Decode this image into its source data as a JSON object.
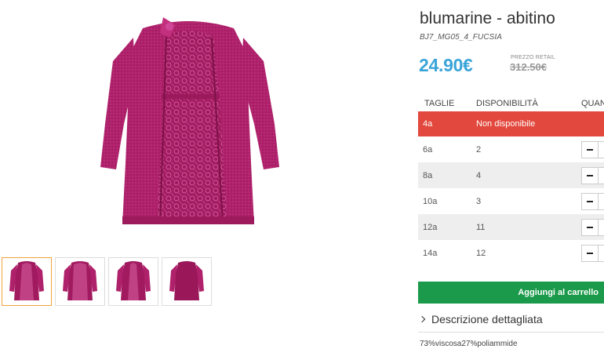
{
  "product": {
    "title": "blumarine - abitino",
    "sku": "BJ7_MG05_4_FUCSIA",
    "price": "24.90€",
    "retail_label": "PREZZO RETAIL",
    "retail_price": "312.50€",
    "color_main": "#b0216b",
    "color_dark": "#8c1553"
  },
  "sizes_table": {
    "headers": [
      "TAGLIE",
      "DISPONIBILITÀ",
      "QUANT"
    ],
    "rows": [
      {
        "size": "4a",
        "availability": "Non disponibile",
        "status": "unavailable"
      },
      {
        "size": "6a",
        "availability": "2",
        "status": "available"
      },
      {
        "size": "8a",
        "availability": "4",
        "status": "available"
      },
      {
        "size": "10a",
        "availability": "3",
        "status": "available"
      },
      {
        "size": "12a",
        "availability": "11",
        "status": "available"
      },
      {
        "size": "14a",
        "availability": "12",
        "status": "available"
      }
    ]
  },
  "actions": {
    "add_to_cart": "Aggiungi al carrello"
  },
  "description": {
    "toggle_label": "Descrizione dettagliata",
    "composition": "73%viscosa27%poliammide"
  },
  "gallery": {
    "thumbnail_count": 4,
    "active_index": 0
  }
}
